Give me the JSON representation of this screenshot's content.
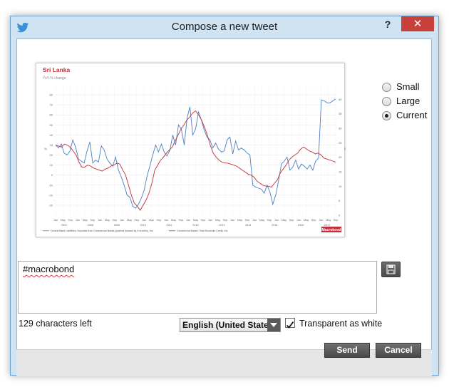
{
  "window": {
    "title": "Compose a new tweet",
    "help_label": "?",
    "close_label": "✕",
    "app_icon": "twitter-bird-icon",
    "accent": "#c7403a"
  },
  "size_options": [
    {
      "label": "Small",
      "selected": false
    },
    {
      "label": "Large",
      "selected": false
    },
    {
      "label": "Current",
      "selected": true
    }
  ],
  "chart_data": {
    "type": "line",
    "title": "Sri Lanka",
    "subtitle": "YoY % change",
    "ylabel_left": "%",
    "ylabel_right": "% pt",
    "brand": "Macrobond",
    "ylim_left": [
      -40,
      90
    ],
    "ylim_right": [
      0,
      45
    ],
    "yticks_left": [
      "80",
      "70",
      "60",
      "50",
      "40",
      "30",
      "20",
      "10",
      "0",
      "-10",
      "-20",
      "-30"
    ],
    "yticks_right": [
      "40",
      "35",
      "30",
      "25",
      "20",
      "15",
      "10",
      "5",
      "0"
    ],
    "x_top": [
      "Jan",
      "May",
      "Sep",
      "Jan",
      "May",
      "Sep",
      "Jan",
      "May",
      "Sep",
      "Jan",
      "May",
      "Sep",
      "Jan",
      "May",
      "Sep",
      "Jan",
      "May",
      "Sep",
      "Jan",
      "May",
      "Sep",
      "Jan",
      "May",
      "Sep",
      "Jan",
      "May",
      "Sep",
      "Jan",
      "May",
      "Sep",
      "Jan",
      "May",
      "Sep",
      "Jan",
      "May",
      "Sep",
      "Jan",
      "May",
      "Sep"
    ],
    "x_years": [
      "2007",
      "2008",
      "2009",
      "2010",
      "2011",
      "2012",
      "2013",
      "2014",
      "2015",
      "2016",
      "2017"
    ],
    "series": [
      {
        "name": "Central Bank Liabilities: Deposits from Commercial Banks (pushed forward by 9 months), lhs",
        "color": "#4a7fc1",
        "values": [
          30,
          27,
          31,
          22,
          20,
          24,
          35,
          28,
          16,
          14,
          12,
          24,
          33,
          12,
          15,
          13,
          29,
          25,
          16,
          12,
          9,
          18,
          5,
          -2,
          -10,
          -20,
          -22,
          -31,
          -33,
          -29,
          -23,
          -15,
          -1,
          9,
          20,
          30,
          23,
          31,
          23,
          19,
          25,
          40,
          30,
          50,
          46,
          30,
          57,
          68,
          40,
          46,
          63,
          55,
          45,
          38,
          35,
          27,
          32,
          26,
          23,
          24,
          35,
          38,
          21,
          34,
          25,
          27,
          25,
          22,
          20,
          -10,
          -12,
          -13,
          -14,
          -18,
          -10,
          -17,
          -29,
          -20,
          -6,
          11,
          14,
          18,
          5,
          8,
          15,
          6,
          11,
          9,
          6,
          10,
          5,
          14,
          17,
          75,
          74,
          72,
          72,
          74,
          76
        ]
      },
      {
        "name": "Commercial Banks: Total Domestic Credit, rhs",
        "color": "#c0303a",
        "values": [
          30,
          29,
          28,
          31,
          30,
          28,
          24,
          20,
          13,
          8,
          8,
          10,
          9,
          7,
          6,
          5,
          4,
          6,
          7,
          9,
          10,
          12,
          11,
          5,
          0,
          -10,
          -20,
          -28,
          -31,
          -35,
          -30,
          -25,
          -18,
          -8,
          5,
          10,
          15,
          18,
          22,
          25,
          28,
          34,
          40,
          46,
          50,
          55,
          58,
          62,
          64,
          60,
          55,
          48,
          40,
          30,
          22,
          18,
          15,
          13,
          12,
          12,
          11,
          10,
          9,
          7,
          5,
          3,
          1,
          0,
          -2,
          -6,
          -8,
          -10,
          -11,
          -11,
          -12,
          -8,
          -5,
          2,
          6,
          10,
          15,
          18,
          20,
          22,
          26,
          28,
          26,
          24,
          23,
          21,
          22,
          20,
          17,
          16,
          15,
          14,
          13
        ]
      }
    ]
  },
  "tweet": {
    "text": "#macrobond",
    "chars_left": "129 characters left"
  },
  "save_icon": "floppy-disk-icon",
  "language": {
    "selected": "English (United States)"
  },
  "transparent": {
    "label": "Transparent as white",
    "checked": true
  },
  "buttons": {
    "send": "Send",
    "cancel": "Cancel"
  }
}
